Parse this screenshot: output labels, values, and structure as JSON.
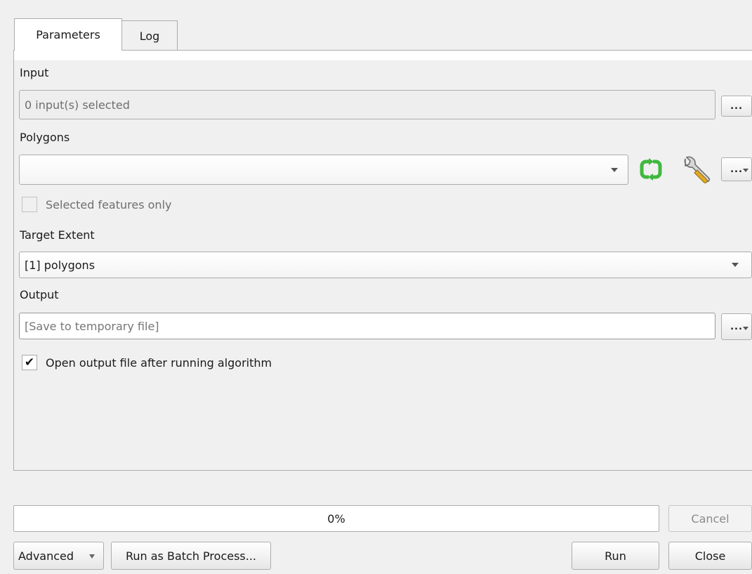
{
  "tabs": [
    {
      "label": "Parameters",
      "active": true
    },
    {
      "label": "Log",
      "active": false
    }
  ],
  "params": {
    "input": {
      "label": "Input",
      "value": "0 input(s) selected",
      "browse": "..."
    },
    "polygons": {
      "label": "Polygons",
      "value": "",
      "more": "...",
      "refresh_icon": "refresh-icon",
      "settings_icon": "wrench-icon"
    },
    "selected_only": {
      "label": "Selected features only",
      "checked": false,
      "enabled": false
    },
    "target_extent": {
      "label": "Target Extent",
      "value": "[1] polygons"
    },
    "output": {
      "label": "Output",
      "placeholder": "[Save to temporary file]",
      "more": "..."
    },
    "open_output": {
      "label": "Open output file after running algorithm",
      "checked": true,
      "check_glyph": "✔"
    }
  },
  "progress": {
    "text": "0%",
    "value": 0
  },
  "buttons": {
    "cancel": "Cancel",
    "advanced": "Advanced",
    "batch": "Run as Batch Process...",
    "run": "Run",
    "close": "Close"
  },
  "colors": {
    "refresh_icon": "#3fb83f",
    "progress_fill": "#3db83d"
  }
}
